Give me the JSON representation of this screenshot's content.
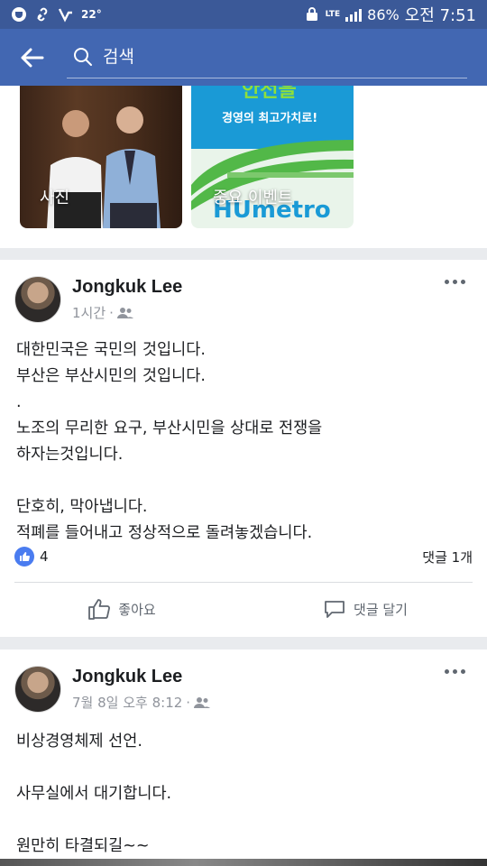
{
  "status_bar": {
    "temperature": "22°",
    "network": "LTE",
    "battery": "86%",
    "time": "오전 7:51"
  },
  "search": {
    "placeholder": "검색"
  },
  "top_tiles": [
    {
      "label": "사진"
    },
    {
      "label": "중요 이벤트",
      "image_text_top": "안전을",
      "image_text_mid": "경영의 최고가치로!",
      "image_text_logo": "HUmetro"
    }
  ],
  "posts": [
    {
      "author": "Jongkuk Lee",
      "time": "1시간",
      "body": "대한민국은 국민의 것입니다.\n부산은 부산시민의 것입니다.\n.\n노조의 무리한 요구, 부산시민을 상대로 전쟁을\n하자는것입니다.\n\n단호히, 막아냅니다.\n적폐를 들어내고 정상적으로 돌려놓겠습니다.",
      "like_count": "4",
      "comment_count": "댓글 1개",
      "like_label": "좋아요",
      "comment_label": "댓글 달기"
    },
    {
      "author": "Jongkuk Lee",
      "time": "7월 8일 오후 8:12",
      "body": "비상경영체제 선언.\n\n사무실에서  대기합니다.\n\n원만히 타결되길~~"
    }
  ],
  "colors": {
    "header_blue": "#4267b2",
    "status_blue": "#3b5998",
    "like_blue": "#4a7cf0"
  }
}
